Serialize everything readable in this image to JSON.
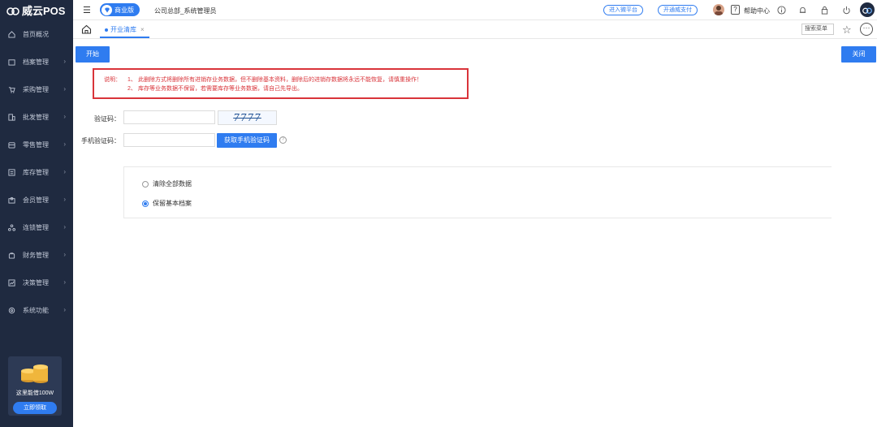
{
  "app": {
    "logo_text": "威云POS",
    "edition": "商业版",
    "org_user": "公司总部_系统管理员"
  },
  "header": {
    "links": [
      "进入微平台",
      "开通威支付"
    ],
    "help_label": "帮助中心"
  },
  "sidebar": {
    "items": [
      {
        "label": "首页概况",
        "icon": "home-icon",
        "has_arrow": false
      },
      {
        "label": "档案管理",
        "icon": "folder-icon",
        "has_arrow": true
      },
      {
        "label": "采购管理",
        "icon": "cart-icon",
        "has_arrow": true
      },
      {
        "label": "批发管理",
        "icon": "building-icon",
        "has_arrow": true
      },
      {
        "label": "零售管理",
        "icon": "store-icon",
        "has_arrow": true
      },
      {
        "label": "库存管理",
        "icon": "warehouse-icon",
        "has_arrow": true
      },
      {
        "label": "会员管理",
        "icon": "member-icon",
        "has_arrow": true
      },
      {
        "label": "连锁管理",
        "icon": "chain-icon",
        "has_arrow": true
      },
      {
        "label": "财务管理",
        "icon": "finance-icon",
        "has_arrow": true
      },
      {
        "label": "决策管理",
        "icon": "chart-icon",
        "has_arrow": true
      },
      {
        "label": "系统功能",
        "icon": "settings-icon",
        "has_arrow": true
      }
    ],
    "promo": {
      "text": "这里能借100W",
      "button": "立即领取"
    }
  },
  "tabs": {
    "active": "开业清库",
    "search_menu": "搜索菜单"
  },
  "toolbar": {
    "start": "开始",
    "close": "关闭"
  },
  "notice": {
    "label": "说明：",
    "lines": [
      {
        "num": "1、",
        "text": "此删除方式将删除所有进销存业务数据，但不删除基本资料，删除后的进销存数据将永远不能恢复，请慎重操作！"
      },
      {
        "num": "2、",
        "text": "库存等业务数据不保留，若需要库存等业务数据，请自己先导出。"
      }
    ]
  },
  "form": {
    "captcha_label": "验证码：",
    "captcha_value": "",
    "captcha_text": "7777",
    "sms_label": "手机验证码：",
    "sms_value": "",
    "sms_button": "获取手机验证码",
    "help_glyph": "?"
  },
  "options": [
    {
      "label": "清除全部数据",
      "checked": false
    },
    {
      "label": "保留基本档案",
      "checked": true
    }
  ],
  "colors": {
    "sidebar_bg": "#1f2a40",
    "primary": "#2f7cf0",
    "warning": "#d9343a"
  }
}
